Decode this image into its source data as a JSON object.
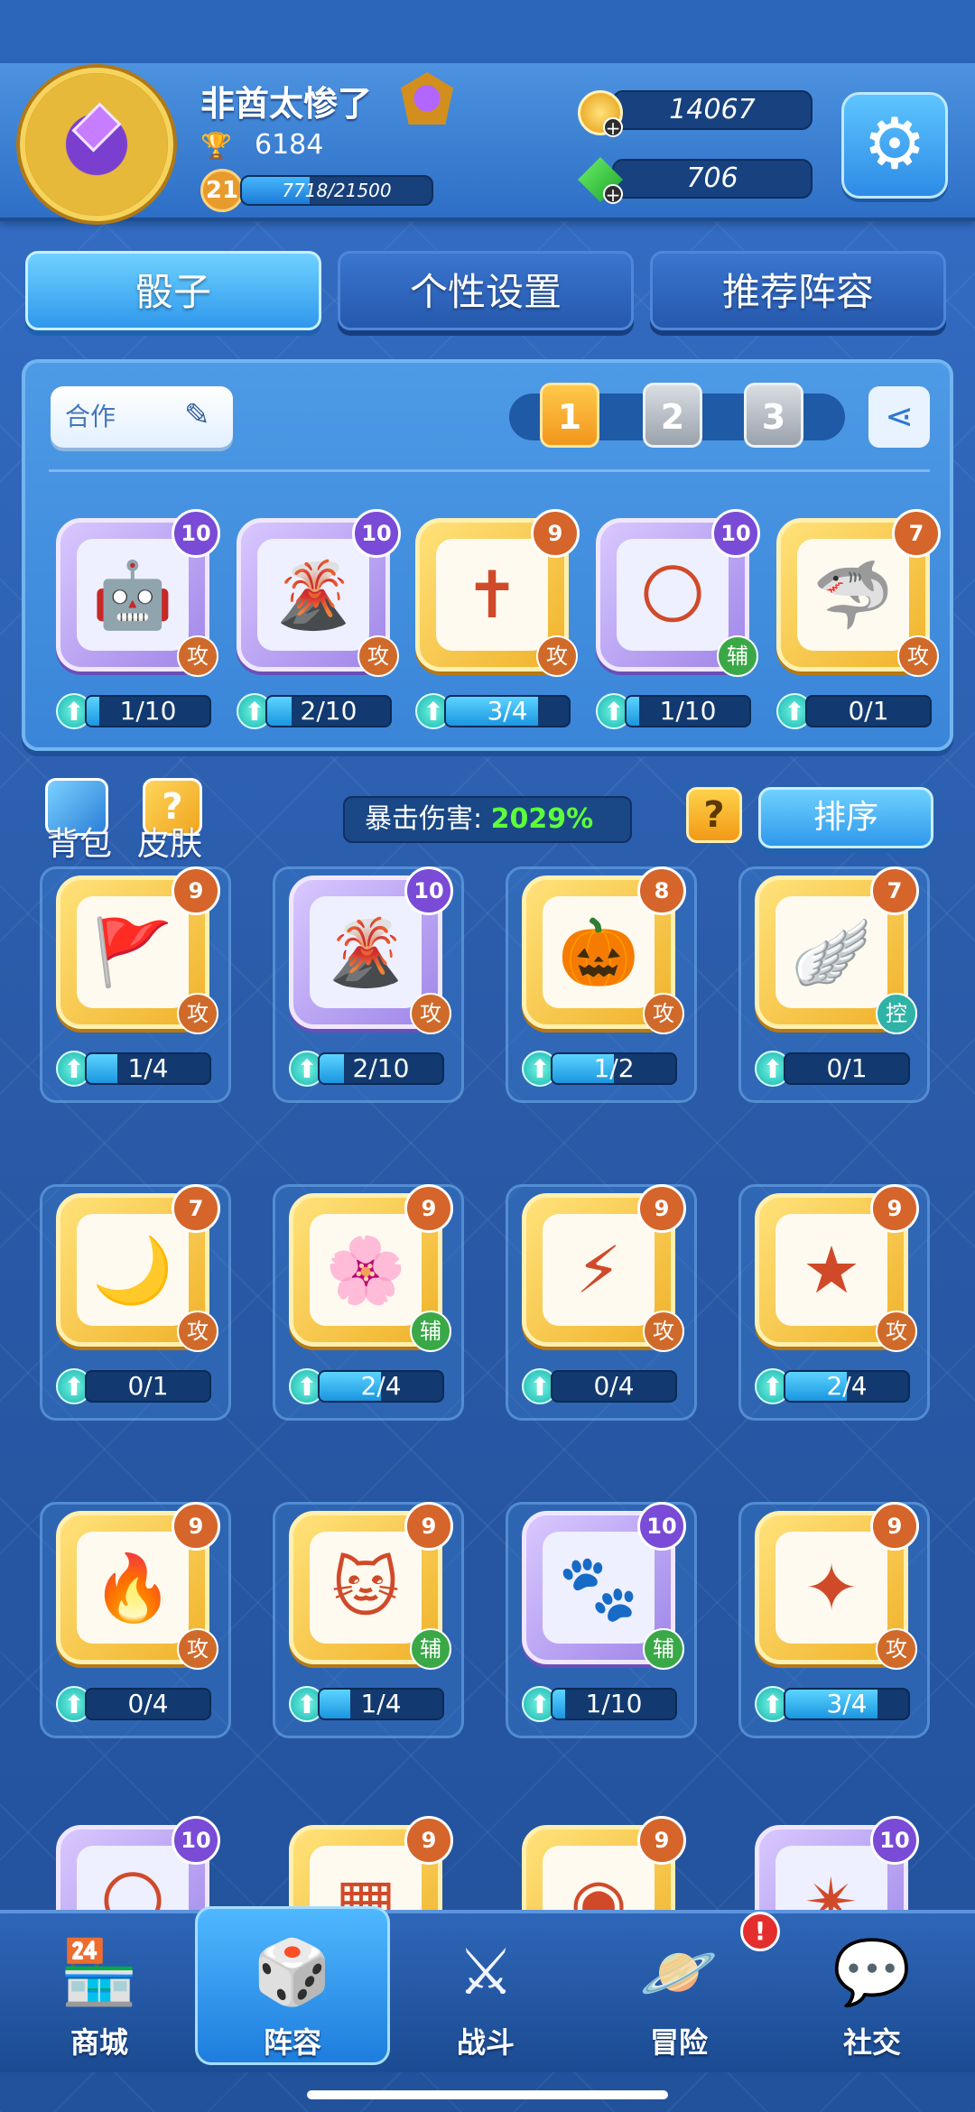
{
  "player": {
    "name": "非酋太惨了",
    "trophies": "6184",
    "level": "21",
    "xp_text": "7718/21500",
    "xp_fraction": 0.359
  },
  "currency": {
    "gold": "14067",
    "gems": "706"
  },
  "tabs": [
    {
      "label": "骰子",
      "active": true
    },
    {
      "label": "个性设置",
      "active": false
    },
    {
      "label": "推荐阵容",
      "active": false
    }
  ],
  "deck": {
    "name": "合作",
    "slots": [
      "1",
      "2",
      "3"
    ],
    "active_slot": "1",
    "dice": [
      {
        "icon": "robot-icon",
        "glyph": "🤖",
        "level": "10",
        "type": "攻",
        "progress": "1/10",
        "fraction": 0.1
      },
      {
        "icon": "volcano-icon",
        "glyph": "🌋",
        "level": "10",
        "type": "攻",
        "progress": "2/10",
        "fraction": 0.2
      },
      {
        "icon": "holy-cross-icon",
        "glyph": "✝",
        "level": "9",
        "type": "攻",
        "progress": "3/4",
        "fraction": 0.75
      },
      {
        "icon": "moon-icon",
        "glyph": "🌕",
        "level": "10",
        "type": "辅",
        "progress": "1/10",
        "fraction": 0.1
      },
      {
        "icon": "shark-icon",
        "glyph": "🦈",
        "level": "7",
        "type": "攻",
        "progress": "0/1",
        "fraction": 0.0
      }
    ]
  },
  "controls": {
    "bag_label": "背包",
    "skin_label": "皮肤",
    "crit_label": "暴击伤害:",
    "crit_value": "2029%",
    "help_label": "?",
    "sort_label": "排序"
  },
  "collection": [
    {
      "icon": "war-banner-icon",
      "glyph": "🚩",
      "level": "9",
      "type": "攻",
      "progress": "1/4",
      "fraction": 0.25
    },
    {
      "icon": "volcano-icon",
      "glyph": "🌋",
      "level": "10",
      "type": "攻",
      "progress": "2/10",
      "fraction": 0.2
    },
    {
      "icon": "pumpkin-icon",
      "glyph": "🎃",
      "level": "8",
      "type": "攻",
      "progress": "1/2",
      "fraction": 0.5
    },
    {
      "icon": "wing-icon",
      "glyph": "🪽",
      "level": "7",
      "type": "控",
      "progress": "0/1",
      "fraction": 0.0
    },
    {
      "icon": "moon-fairy-icon",
      "glyph": "🌙",
      "level": "7",
      "type": "攻",
      "progress": "0/1",
      "fraction": 0.0
    },
    {
      "icon": "sakura-icon",
      "glyph": "🌸",
      "level": "9",
      "type": "辅",
      "progress": "2/4",
      "fraction": 0.5
    },
    {
      "icon": "thunder-hammer-icon",
      "glyph": "⚡",
      "level": "9",
      "type": "攻",
      "progress": "0/4",
      "fraction": 0.0
    },
    {
      "icon": "star-icon",
      "glyph": "★",
      "level": "9",
      "type": "攻",
      "progress": "2/4",
      "fraction": 0.5
    },
    {
      "icon": "fire-dragon-icon",
      "glyph": "🔥",
      "level": "9",
      "type": "攻",
      "progress": "0/4",
      "fraction": 0.0
    },
    {
      "icon": "lucky-cat-icon",
      "glyph": "🐱",
      "level": "9",
      "type": "辅",
      "progress": "1/4",
      "fraction": 0.25
    },
    {
      "icon": "paw-print-icon",
      "glyph": "🐾",
      "level": "10",
      "type": "辅",
      "progress": "1/10",
      "fraction": 0.1
    },
    {
      "icon": "golden-crown-icon",
      "glyph": "✦",
      "level": "9",
      "type": "攻",
      "progress": "3/4",
      "fraction": 0.75
    },
    {
      "icon": "moon-icon",
      "glyph": "🌕",
      "level": "10"
    },
    {
      "icon": "pink-grid-icon",
      "glyph": "▦",
      "level": "9"
    },
    {
      "icon": "wifi-wave-icon",
      "glyph": "◉",
      "level": "9"
    },
    {
      "icon": "crack-icon",
      "glyph": "✴",
      "level": "10"
    }
  ],
  "nav": [
    {
      "label": "商城",
      "icon": "shop-icon",
      "glyph": "🏪"
    },
    {
      "label": "阵容",
      "icon": "dice-icon",
      "glyph": "🎲",
      "active": true
    },
    {
      "label": "战斗",
      "icon": "crossed-swords-icon",
      "glyph": "⚔"
    },
    {
      "label": "冒险",
      "icon": "planet-icon",
      "glyph": "🪐",
      "alert": "!"
    },
    {
      "label": "社交",
      "icon": "chat-icon",
      "glyph": "💬"
    }
  ]
}
